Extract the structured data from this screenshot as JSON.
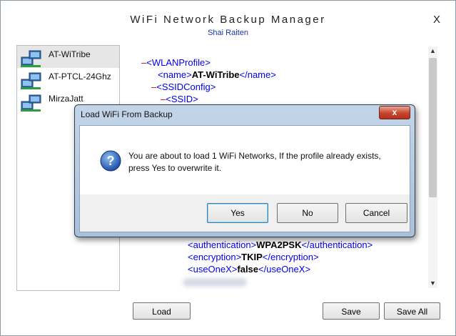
{
  "app": {
    "title": "WiFi Network Backup Manager",
    "subtitle": "Shai Raiten",
    "close_label": "X"
  },
  "networks": [
    {
      "label": "AT-WiTribe",
      "selected": true
    },
    {
      "label": "AT-PTCL-24Ghz",
      "selected": false
    },
    {
      "label": "MirzaJatt",
      "selected": false
    }
  ],
  "xml": {
    "line1": {
      "minus": "–",
      "tag": "<WLANProfile>"
    },
    "line2": {
      "open": "<name>",
      "text": "AT-WiTribe",
      "close": "</name>"
    },
    "line3": {
      "minus": "–",
      "tag": "<SSIDConfig>"
    },
    "line4": {
      "minus": "–",
      "tag": "<SSID>"
    },
    "line5": {
      "open": "<authentication>",
      "text": "WPA2PSK",
      "close": "</authentication>"
    },
    "line6": {
      "open": "<encryption>",
      "text": "TKIP",
      "close": "</encryption>"
    },
    "line7": {
      "open": "<useOneX>",
      "text": "false",
      "close": "</useOneX>"
    }
  },
  "scrollbar": {
    "up": "▲",
    "down": "▼"
  },
  "buttons": {
    "load": "Load",
    "save": "Save",
    "save_all": "Save All"
  },
  "dialog": {
    "title": "Load WiFi From Backup",
    "close": "x",
    "message": "You are about to load 1 WiFi Networks, If the profile already exists, press Yes to overwrite it.",
    "yes": "Yes",
    "no": "No",
    "cancel": "Cancel"
  },
  "colors": {
    "xml_tag": "#0000ee",
    "xml_minus": "#cc0000",
    "subtitle": "#1a35b0",
    "dialog_frame": "#b3c8df",
    "dialog_close": "#c7442d"
  },
  "icons": {
    "network": "network-computer-icon",
    "question": "question-icon"
  }
}
